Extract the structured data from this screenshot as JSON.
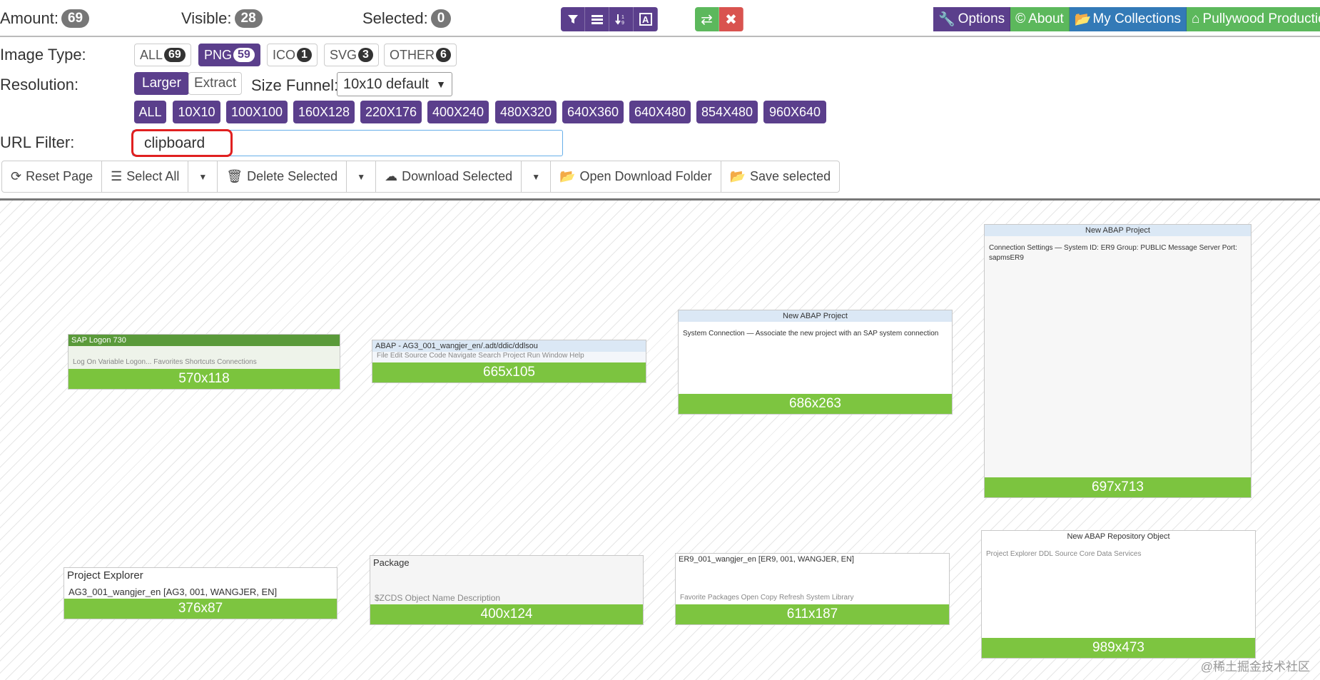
{
  "header": {
    "amount_label": "Amount:",
    "amount_count": "69",
    "visible_label": "Visible:",
    "visible_count": "28",
    "selected_label": "Selected:",
    "selected_count": "0",
    "tool_icons": [
      "filter-icon",
      "list-icon",
      "sort-icon",
      "text-icon"
    ],
    "swap_icon": "⇄",
    "close_icon": "✖"
  },
  "nav": {
    "options": "Options",
    "about": "About",
    "collections": "My Collections",
    "pullywood": "Pullywood Productio"
  },
  "filters": {
    "image_type_label": "Image Type:",
    "types": [
      {
        "label": "ALL",
        "count": "69"
      },
      {
        "label": "PNG",
        "count": "59"
      },
      {
        "label": "ICO",
        "count": "1"
      },
      {
        "label": "SVG",
        "count": "3"
      },
      {
        "label": "OTHER",
        "count": "6"
      }
    ],
    "resolution_label": "Resolution:",
    "larger": "Larger",
    "extract": "Extract",
    "size_funnel_label": "Size Funnel:",
    "size_funnel_value": "10x10 default",
    "resolutions": [
      "ALL",
      "10X10",
      "100X100",
      "160X128",
      "220X176",
      "400X240",
      "480X320",
      "640X360",
      "640X480",
      "854X480",
      "960X640"
    ],
    "url_filter_label": "URL Filter:",
    "url_filter_value": "clipboard"
  },
  "actions": {
    "reset": "Reset Page",
    "select_all": "Select All",
    "delete_selected": "Delete Selected",
    "download_selected": "Download Selected",
    "open_folder": "Open Download Folder",
    "save_selected": "Save selected"
  },
  "thumbs": [
    {
      "size": "570x118",
      "title": "SAP Logon 730",
      "line": "Log On  Variable Logon...  Favorites  Shortcuts  Connections"
    },
    {
      "size": "665x105",
      "title": "ABAP - AG3_001_wangjer_en/.adt/ddic/ddlsou",
      "line": "File  Edit  Source Code  Navigate  Search  Project  Run  Window  Help"
    },
    {
      "size": "686x263",
      "title": "New ABAP Project",
      "line": "System Connection — Associate the new project with an SAP system connection"
    },
    {
      "size": "697x713",
      "title": "New ABAP Project",
      "line": "Connection Settings — System ID: ER9  Group: PUBLIC  Message Server Port: sapmsER9"
    },
    {
      "size": "376x87",
      "title": "Project Explorer",
      "line": "AG3_001_wangjer_en [AG3, 001, WANGJER, EN]"
    },
    {
      "size": "400x124",
      "title": "Package",
      "line": "$ZCDS  Object Name  Description"
    },
    {
      "size": "611x187",
      "title": "ER9_001_wangjer_en [ER9, 001, WANGJER, EN]",
      "line": "Favorite Packages  Open  Copy  Refresh  System Library"
    },
    {
      "size": "989x473",
      "title": "New ABAP Repository Object",
      "line": "Project Explorer  DDL Source  Core Data Services"
    }
  ],
  "watermark": "@稀土掘金技术社区"
}
